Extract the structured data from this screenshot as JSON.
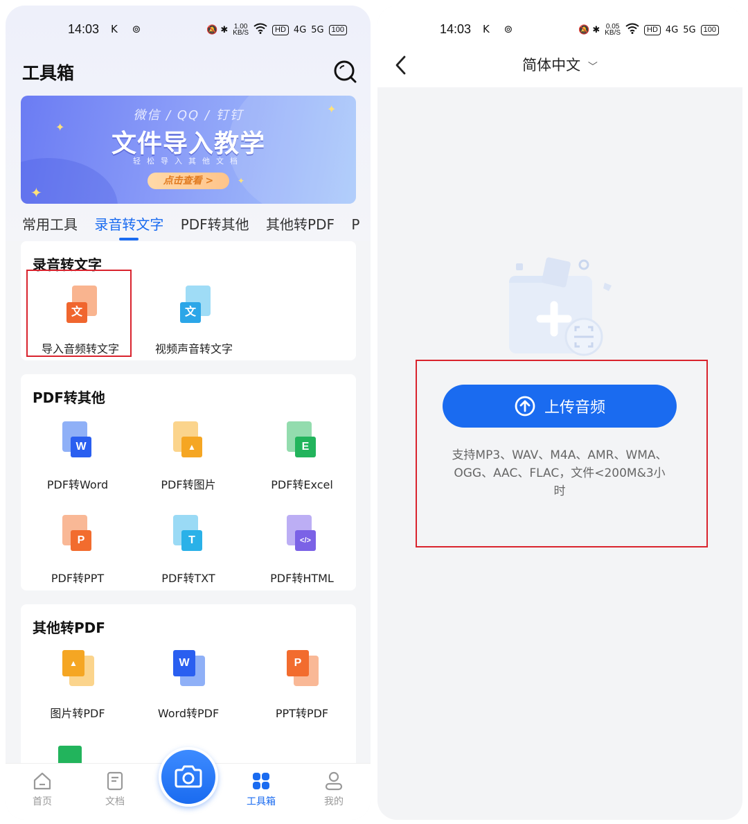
{
  "left": {
    "status": {
      "time": "14:03",
      "speed_value": "1.00",
      "speed_unit": "KB/S",
      "battery": "100",
      "left_icons": "K ⊚",
      "right_icons": "🔕 ✱",
      "hd": "HD",
      "net1": "4G",
      "net2": "5G"
    },
    "title": "工具箱",
    "banner": {
      "subtitle": "微信 / QQ / 钉钉",
      "title": "文件导入教学",
      "tagline": "轻松导入其他文档",
      "cta": "点击查看 >"
    },
    "tabs": [
      "常用工具",
      "录音转文字",
      "PDF转其他",
      "其他转PDF",
      "P"
    ],
    "active_tab": 1,
    "sections": [
      {
        "title": "录音转文字",
        "items": [
          {
            "label": "导入音频转文字",
            "icon": "audio-file-icon",
            "glyph": "文",
            "color": "#f0662e"
          },
          {
            "label": "视频声音转文字",
            "icon": "video-file-icon",
            "glyph": "文",
            "color": "#2ba6e8"
          }
        ]
      },
      {
        "title": "PDF转其他",
        "items": [
          {
            "label": "PDF转Word",
            "icon": "word-icon",
            "glyph": "W",
            "color": "#2a5ff0"
          },
          {
            "label": "PDF转图片",
            "icon": "image-icon",
            "glyph": "▲",
            "color": "#f5a623"
          },
          {
            "label": "PDF转Excel",
            "icon": "excel-icon",
            "glyph": "E",
            "color": "#22b45c"
          },
          {
            "label": "PDF转PPT",
            "icon": "ppt-icon",
            "glyph": "P",
            "color": "#f26c2e"
          },
          {
            "label": "PDF转TXT",
            "icon": "txt-icon",
            "glyph": "T",
            "color": "#2ab1e8"
          },
          {
            "label": "PDF转HTML",
            "icon": "html-icon",
            "glyph": "</>",
            "color": "#7b62e6"
          }
        ]
      },
      {
        "title": "其他转PDF",
        "items": [
          {
            "label": "图片转PDF",
            "icon": "image-to-pdf-icon",
            "glyph": "▲",
            "color": "#f5a623"
          },
          {
            "label": "Word转PDF",
            "icon": "word-to-pdf-icon",
            "glyph": "W",
            "color": "#2a5ff0"
          },
          {
            "label": "PPT转PDF",
            "icon": "ppt-to-pdf-icon",
            "glyph": "P",
            "color": "#f26c2e"
          }
        ]
      }
    ],
    "nav": [
      {
        "label": "首页",
        "icon": "home-icon"
      },
      {
        "label": "文档",
        "icon": "document-icon"
      },
      {
        "label": "工具箱",
        "icon": "toolbox-icon",
        "active": true
      },
      {
        "label": "我的",
        "icon": "profile-icon"
      }
    ]
  },
  "right": {
    "status": {
      "time": "14:03",
      "speed_value": "0.05",
      "speed_unit": "KB/S",
      "battery": "100",
      "left_icons": "K ⊚",
      "right_icons": "🔕 ✱",
      "hd": "HD",
      "net1": "4G",
      "net2": "5G"
    },
    "language": "简体中文",
    "upload_label": "上传音频",
    "support_text": "支持MP3、WAV、M4A、AMR、WMA、OGG、AAC、FLAC，文件<200M&3小时"
  },
  "colors": {
    "accent": "#1a6bf0",
    "highlight_box": "#d9232d"
  }
}
